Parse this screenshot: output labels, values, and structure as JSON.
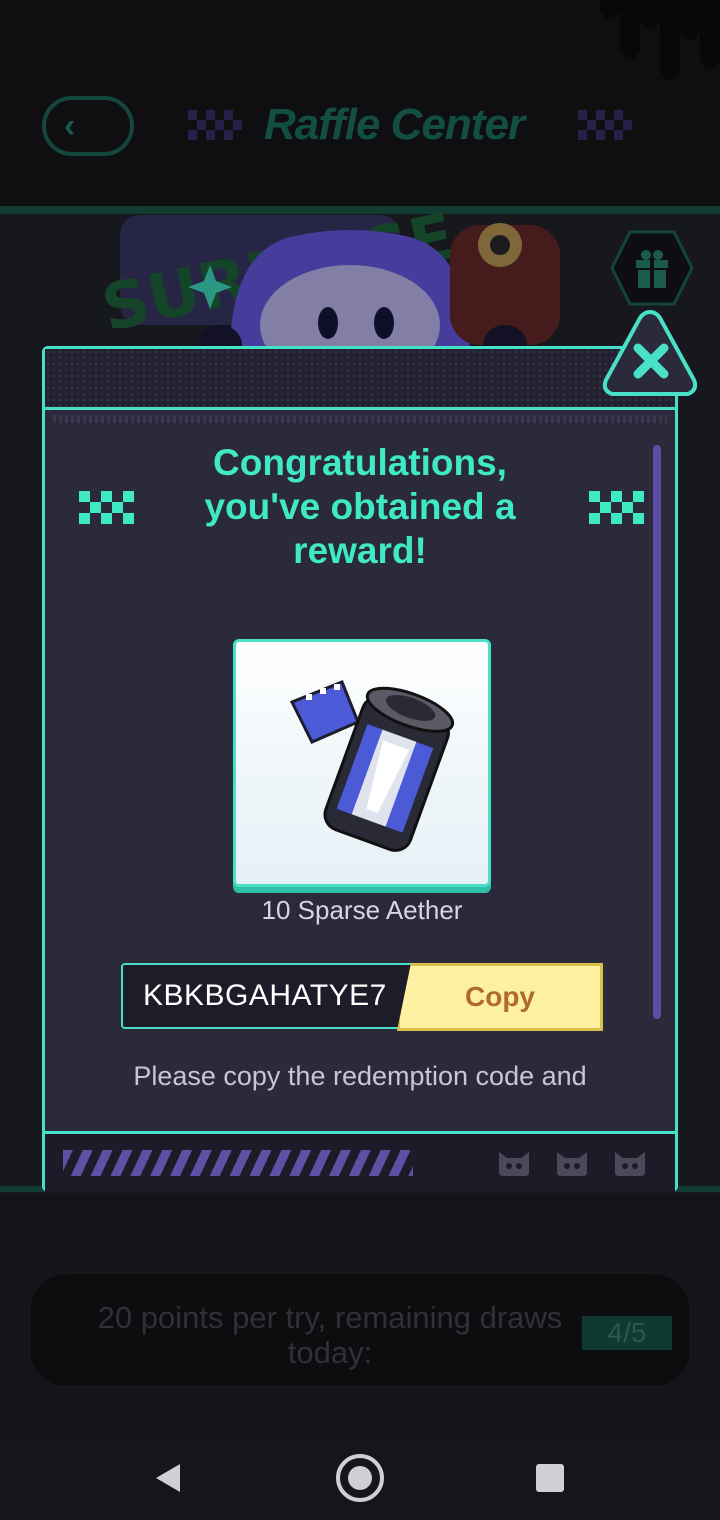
{
  "header": {
    "title": "Raffle Center",
    "back_icon": "back-arrow-icon",
    "gift_icon": "gift-icon"
  },
  "modal": {
    "heading": "Congratulations, you've obtained a reward!",
    "reward": {
      "name": "10 Sparse Aether",
      "icon": "film-canister-icon"
    },
    "redemption_code": "KBKBGAHATYE7",
    "copy_label": "Copy",
    "instructions": "Please copy the redemption code and",
    "close_icon": "close-icon",
    "colors": {
      "accent": "#49e0c8",
      "heading": "#3fe9c4",
      "copy_bg": "#fdf0a0",
      "copy_text": "#b06a2a"
    }
  },
  "draw_panel": {
    "text": "20 points per try, remaining draws today:",
    "count": "4/5"
  },
  "navbar": {
    "back_icon": "nav-back-icon",
    "home_icon": "nav-home-icon",
    "recent_icon": "nav-recents-icon"
  }
}
